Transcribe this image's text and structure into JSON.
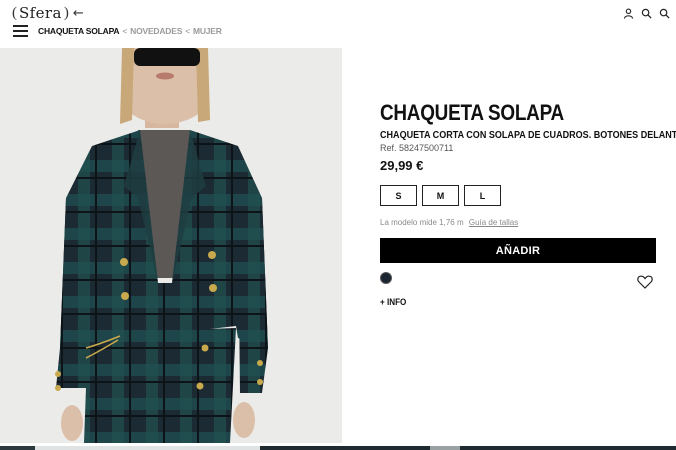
{
  "brand": {
    "name": "Sfera",
    "open_paren": "(",
    "close_paren": ")",
    "back_arrow": "←"
  },
  "header": {
    "icons": [
      "user-icon",
      "search-icon",
      "bag-icon"
    ]
  },
  "breadcrumb": {
    "current": "CHAQUETA SOLAPA",
    "sep": "<",
    "items": [
      "NOVEDADES",
      "MUJER"
    ]
  },
  "product": {
    "title": "CHAQUETA SOLAPA",
    "subtitle": "CHAQUETA CORTA CON SOLAPA DE CUADROS. BOTONES DELANTEROS.",
    "ref": "Ref. 58247500711",
    "price": "29,99 €",
    "sizes": [
      "S",
      "M",
      "L"
    ],
    "model_text": "La modelo mide 1,76 m",
    "size_guide": "Guía de tallas",
    "add_label": "AÑADIR",
    "more_info": "+ INFO",
    "swatch_color": "#1a2530"
  },
  "colors": {
    "accent": "#000000",
    "plaid_dark": "#16232b",
    "plaid_green": "#1f4a4c"
  }
}
